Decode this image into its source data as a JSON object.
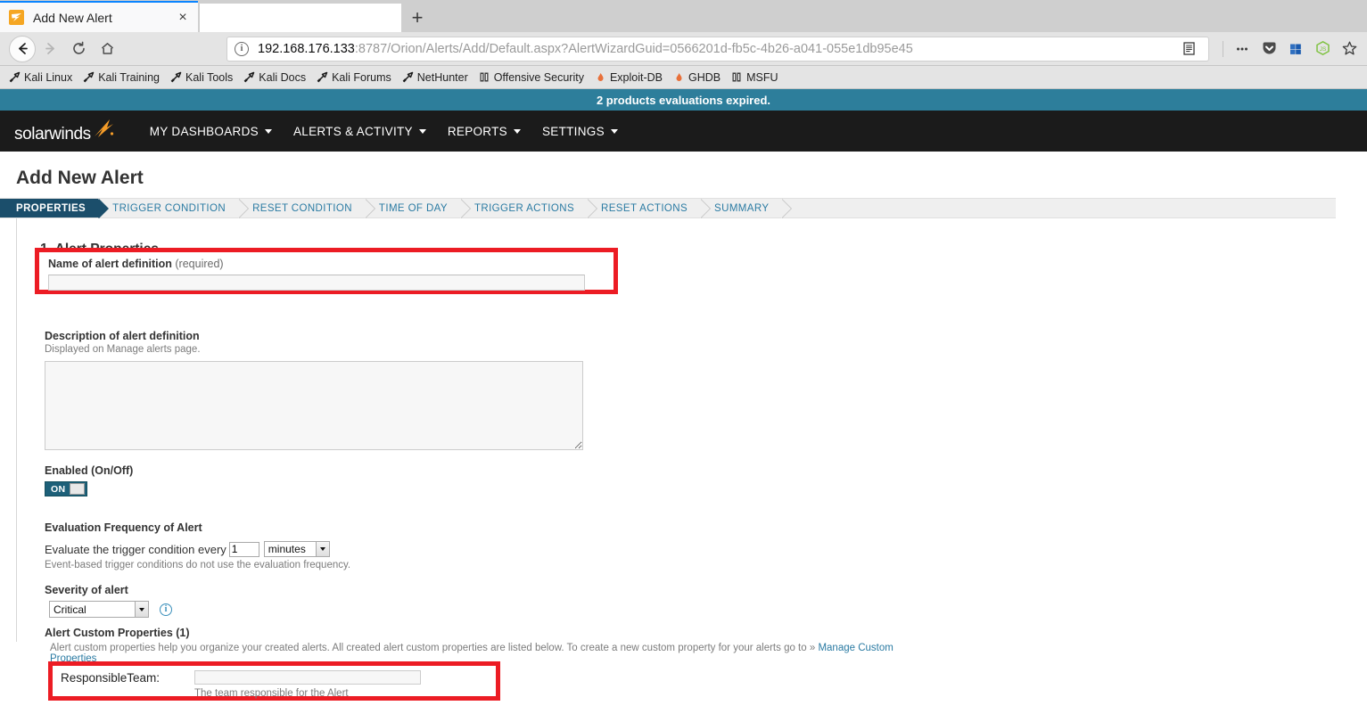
{
  "browser": {
    "tab": {
      "title": "Add New Alert",
      "favicon": "solarwinds-favicon",
      "close": "×"
    },
    "newtab_label": "+",
    "nav": {
      "back": "back-arrow-icon",
      "forward": "forward-arrow-icon",
      "reload": "reload-icon",
      "home": "home-icon"
    },
    "url": {
      "host": "192.168.176.133",
      "path": ":8787/Orion/Alerts/Add/Default.aspx?AlertWizardGuid=0566201d-fb5c-4b26-a041-055e1db95e45",
      "full": "192.168.176.133:8787/Orion/Alerts/Add/Default.aspx?AlertWizardGuid=0566201d-fb5c-4b26-a041-055e1db95e45",
      "info_icon": "i"
    },
    "toolbar_icons": [
      {
        "name": "reader-view-icon"
      },
      {
        "name": "page-actions-icon"
      },
      {
        "name": "pocket-icon"
      },
      {
        "name": "windows-app-icon"
      },
      {
        "name": "nodejs-icon"
      },
      {
        "name": "bookmark-star-icon"
      }
    ],
    "bookmarks": [
      {
        "label": "Kali Linux",
        "icon": "dragon-icon"
      },
      {
        "label": "Kali Training",
        "icon": "dragon-icon"
      },
      {
        "label": "Kali Tools",
        "icon": "dragon-icon"
      },
      {
        "label": "Kali Docs",
        "icon": "dragon-icon"
      },
      {
        "label": "Kali Forums",
        "icon": "dragon-icon"
      },
      {
        "label": "NetHunter",
        "icon": "dragon-icon"
      },
      {
        "label": "Offensive Security",
        "icon": "book-icon"
      },
      {
        "label": "Exploit-DB",
        "icon": "flame-icon"
      },
      {
        "label": "GHDB",
        "icon": "flame-icon"
      },
      {
        "label": "MSFU",
        "icon": "book-icon"
      }
    ]
  },
  "banner": {
    "text": "2 products evaluations expired."
  },
  "nav": {
    "logo": "solarwinds",
    "items": [
      {
        "label": "MY DASHBOARDS"
      },
      {
        "label": "ALERTS & ACTIVITY"
      },
      {
        "label": "REPORTS"
      },
      {
        "label": "SETTINGS"
      }
    ]
  },
  "page": {
    "title": "Add New Alert",
    "wizard_steps": [
      {
        "label": "PROPERTIES",
        "active": true
      },
      {
        "label": "TRIGGER CONDITION",
        "active": false
      },
      {
        "label": "RESET CONDITION",
        "active": false
      },
      {
        "label": "TIME OF DAY",
        "active": false
      },
      {
        "label": "TRIGGER ACTIONS",
        "active": false
      },
      {
        "label": "RESET ACTIONS",
        "active": false
      },
      {
        "label": "SUMMARY",
        "active": false
      }
    ],
    "section_title": "1. Alert Properties",
    "name_field": {
      "label": "Name of alert definition",
      "required_suffix": "(required)",
      "value": ""
    },
    "description_field": {
      "label": "Description of alert definition",
      "hint": "Displayed on Manage alerts page.",
      "value": ""
    },
    "enabled": {
      "label": "Enabled (On/Off)",
      "state": "ON"
    },
    "evaluation": {
      "label": "Evaluation Frequency of Alert",
      "prefix": "Evaluate the trigger condition every",
      "value": "1",
      "unit": "minutes",
      "hint": "Event-based trigger conditions do not use the evaluation frequency."
    },
    "severity": {
      "label": "Severity of alert",
      "value": "Critical",
      "info_icon": "i"
    },
    "custom_properties": {
      "label": "Alert Custom Properties (1)",
      "description": "Alert custom properties help you organize your created alerts. All created alert custom properties are listed below. To create a new custom property for your alerts go to »",
      "link_label": "Manage Custom Properties",
      "rows": [
        {
          "name": "ResponsibleTeam:",
          "value": "",
          "hint": "The team responsible for the Alert"
        }
      ]
    }
  },
  "colors": {
    "highlight": "#ec1c24",
    "banner_bg": "#2d7e9b",
    "nav_bg": "#1b1b1b",
    "accent_link": "#2b7ba3",
    "wizard_active_bg": "#1b4e6b",
    "toggle_on_bg": "#1d6079",
    "brand_orange": "#f5a623"
  }
}
